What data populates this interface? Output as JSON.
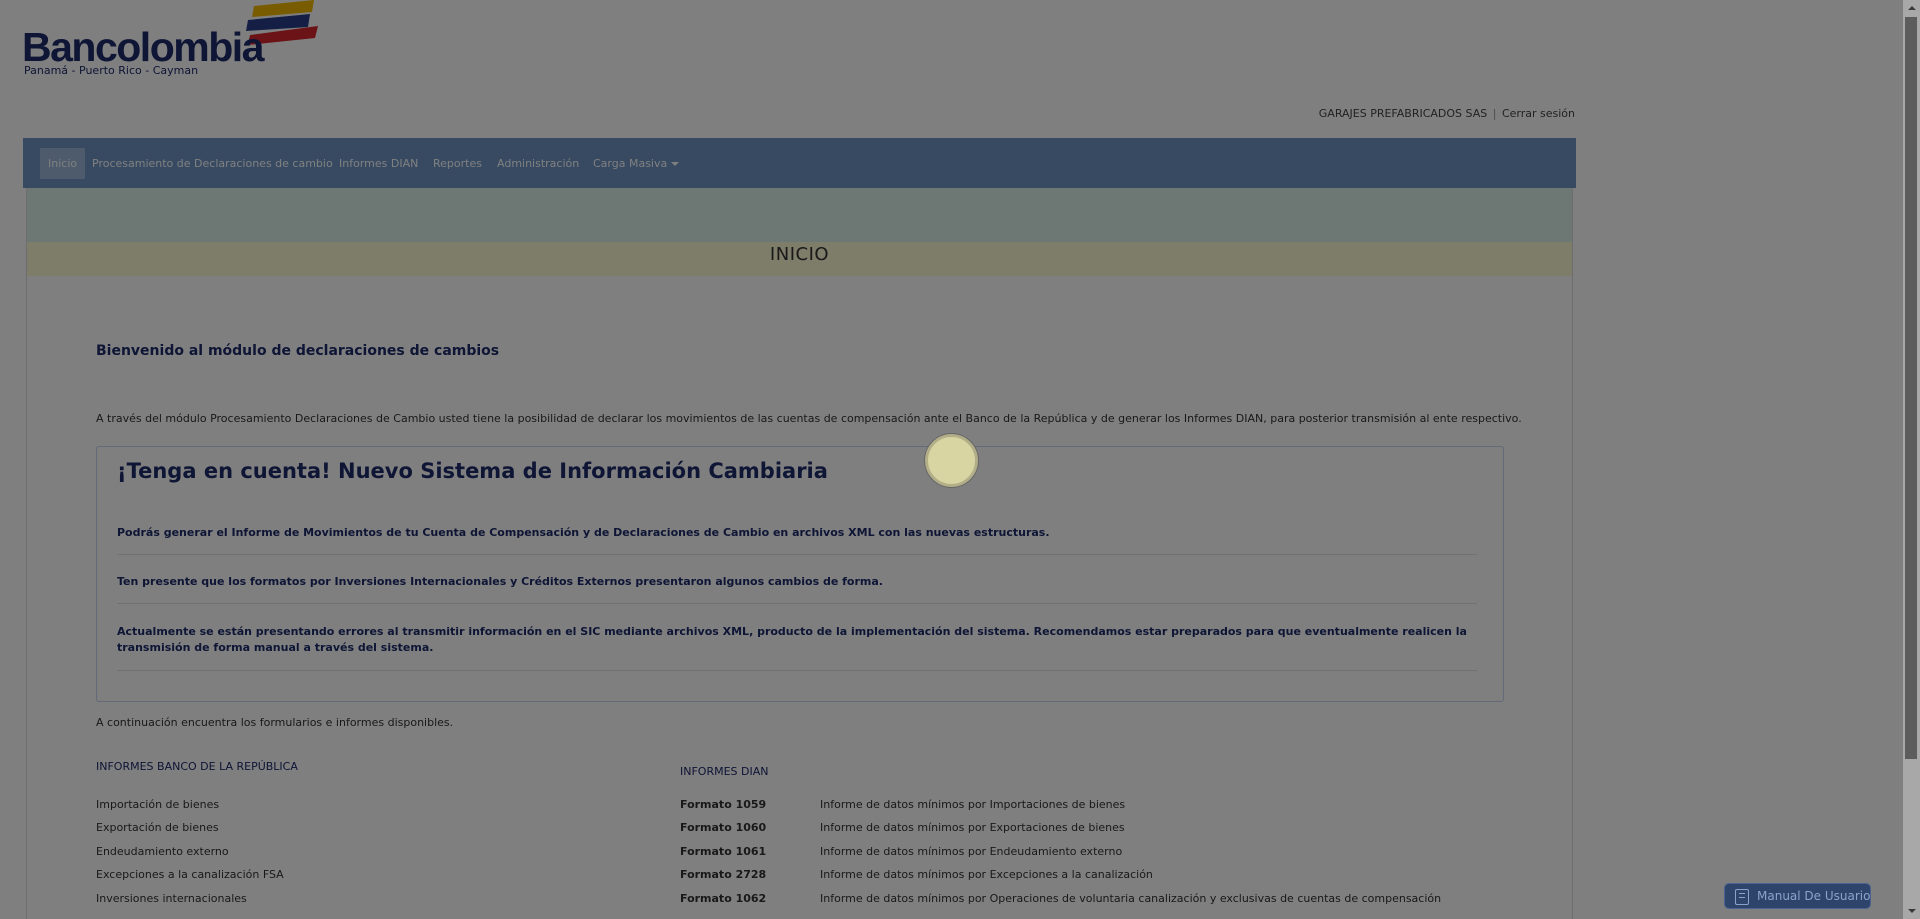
{
  "header": {
    "brand": "Bancolombia",
    "brand_sub": "Panamá - Puerto Rico - Cayman",
    "user_company": "GARAJES PREFABRICADOS SAS",
    "separator": "|",
    "logout_label": "Cerrar sesión"
  },
  "nav": {
    "items": [
      {
        "label": "Inicio"
      },
      {
        "label": "Procesamiento de Declaraciones de cambio"
      },
      {
        "label": "Informes DIAN"
      },
      {
        "label": "Reportes"
      },
      {
        "label": "Administración"
      },
      {
        "label": "Carga Masiva"
      }
    ]
  },
  "main": {
    "page_title": "INICIO",
    "welcome": "Bienvenido al módulo de declaraciones de cambios",
    "intro": "A través del módulo Procesamiento Declaraciones de Cambio usted tiene la posibilidad de declarar los movimientos de las cuentas de compensación ante el Banco de la República y de generar los Informes DIAN, para posterior transmisión al ente respectivo.",
    "notice": {
      "title": "¡Tenga en cuenta! Nuevo Sistema de Información Cambiaria",
      "p1": "Podrás generar el Informe de Movimientos de tu Cuenta de Compensación y de Declaraciones de Cambio en archivos XML con las nuevas estructuras.",
      "p2": "Ten presente que los formatos por Inversiones Internacionales y Créditos Externos presentaron algunos cambios de forma.",
      "p3": "Actualmente se están presentando errores al transmitir información en el SIC mediante archivos XML, producto de la implementación del sistema. Recomendamos estar preparados para que eventualmente realicen la transmisión de forma manual a través del sistema."
    },
    "available": "A continuación encuentra los formularios e informes disponibles.",
    "banco_title": "INFORMES BANCO DE LA REPÚBLICA",
    "banco_items": [
      "Importación de bienes",
      "Exportación de bienes",
      "Endeudamiento externo",
      "Excepciones a la canalización FSA",
      "Inversiones internacionales"
    ],
    "dian_title": "INFORMES DIAN",
    "dian_items": [
      {
        "format": "Formato 1059",
        "desc": "Informe de datos mínimos por Importaciones de bienes"
      },
      {
        "format": "Formato 1060",
        "desc": "Informe de datos mínimos por Exportaciones de bienes"
      },
      {
        "format": "Formato 1061",
        "desc": "Informe de datos mínimos por Endeudamiento externo"
      },
      {
        "format": "Formato 2728",
        "desc": "Informe de datos mínimos por Excepciones a la canalización"
      },
      {
        "format": "Formato 1062",
        "desc": "Informe de datos mínimos por Operaciones de voluntaria canalización y exclusivas de cuentas de compensación"
      }
    ]
  },
  "manual_button": "Manual De Usuario",
  "colors": {
    "navbar": "#6f95c4",
    "brand_blue": "#1c2a6b",
    "overlay": "rgba(0,0,0,0.5)"
  },
  "icons": [
    "caret-down-icon",
    "book-icon",
    "loading-spinner"
  ]
}
